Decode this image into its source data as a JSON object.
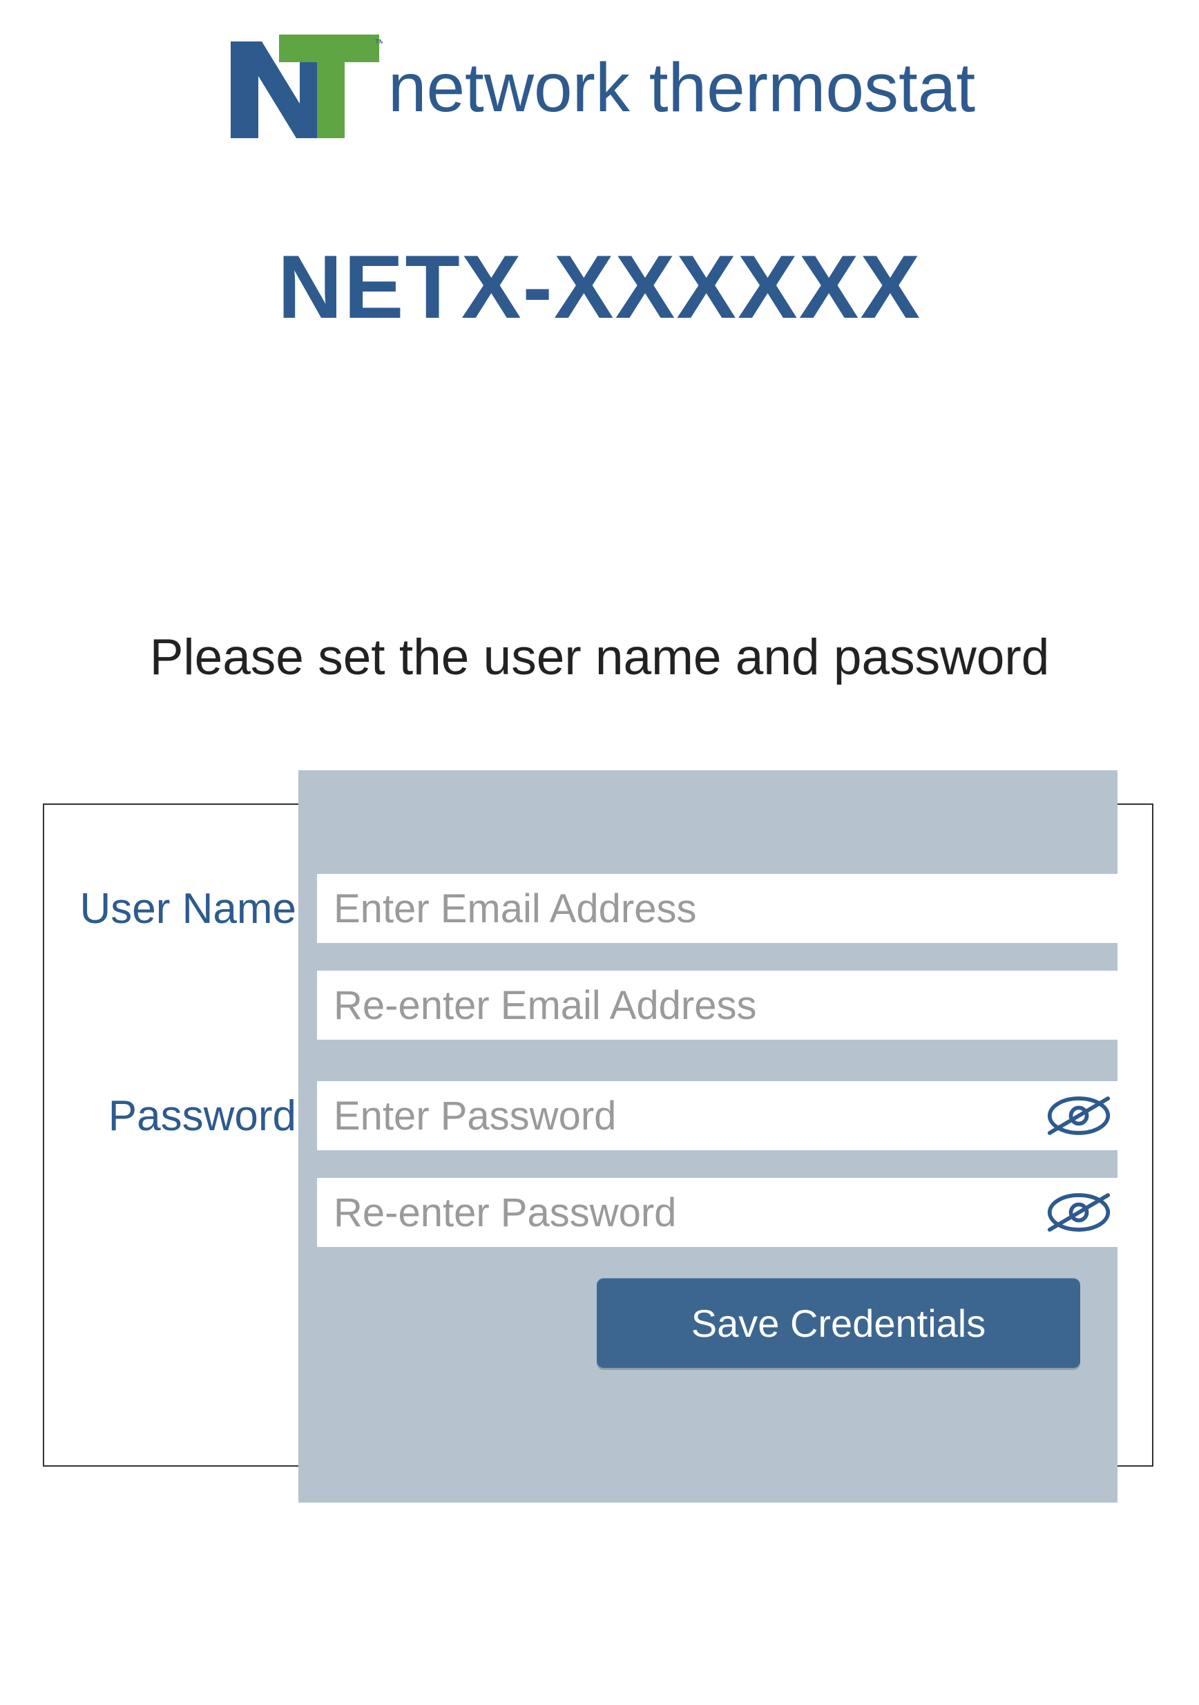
{
  "brand": {
    "name": "network thermostat",
    "mark_tm": "™"
  },
  "device_id": "NETX-XXXXXX",
  "instruction": "Please set the user name and password",
  "form": {
    "username_label": "User Name",
    "password_label": "Password",
    "fields": {
      "email": {
        "placeholder": "Enter Email Address",
        "value": ""
      },
      "email_confirm": {
        "placeholder": "Re-enter Email Address",
        "value": ""
      },
      "password": {
        "placeholder": "Enter Password",
        "value": ""
      },
      "password_confirm": {
        "placeholder": "Re-enter Password",
        "value": ""
      }
    },
    "save_label": "Save Credentials"
  },
  "colors": {
    "brand_blue": "#2e5a8e",
    "brand_green": "#5fa544",
    "panel_grey": "#b6c3ce",
    "button_blue": "#3c6690"
  },
  "icons": {
    "toggle_password_visibility": "eye-off-icon"
  }
}
